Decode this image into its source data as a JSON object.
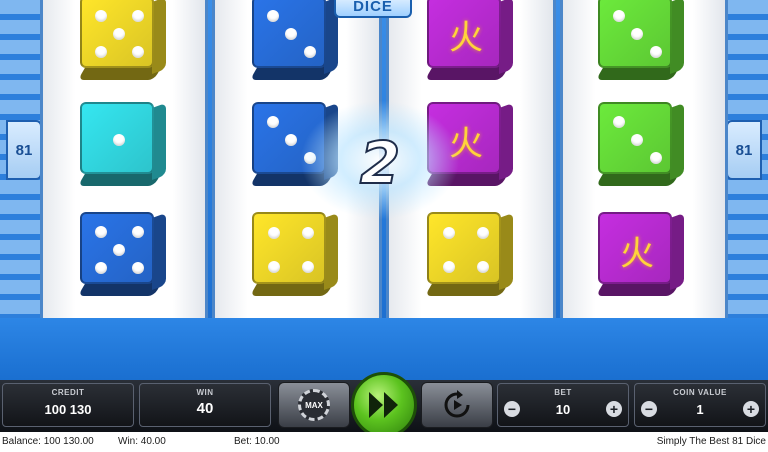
{
  "header": {
    "title_tag": "DICE"
  },
  "side_badges": {
    "left": "81",
    "right": "81"
  },
  "win_indicator": "2",
  "colors": {
    "yellow": "#ffe62a",
    "cyan": "#35e6f0",
    "blue": "#2a74e8",
    "magenta": "#c52ee0",
    "green": "#6cea3c"
  },
  "reels": [
    {
      "name": "reel-1",
      "dice": [
        {
          "color": "yellow",
          "symbol": "five",
          "icon": "die-five-icon"
        },
        {
          "color": "cyan",
          "symbol": "one",
          "icon": "die-one-icon"
        },
        {
          "color": "blue",
          "symbol": "five",
          "icon": "die-five-icon"
        }
      ]
    },
    {
      "name": "reel-2",
      "dice": [
        {
          "color": "blue",
          "symbol": "three",
          "icon": "die-three-icon"
        },
        {
          "color": "blue",
          "symbol": "three",
          "icon": "die-three-icon"
        },
        {
          "color": "yellow",
          "symbol": "four",
          "icon": "die-four-icon"
        }
      ]
    },
    {
      "name": "reel-3",
      "dice": [
        {
          "color": "magenta",
          "symbol": "fire",
          "icon": "fire-glyph-icon",
          "glyph": "火"
        },
        {
          "color": "magenta",
          "symbol": "fire",
          "icon": "fire-glyph-icon",
          "glyph": "火"
        },
        {
          "color": "yellow",
          "symbol": "four",
          "icon": "die-four-icon"
        }
      ]
    },
    {
      "name": "reel-4",
      "dice": [
        {
          "color": "green",
          "symbol": "three",
          "icon": "die-three-icon"
        },
        {
          "color": "green",
          "symbol": "three",
          "icon": "die-three-icon"
        },
        {
          "color": "magenta",
          "symbol": "fire",
          "icon": "fire-glyph-icon",
          "glyph": "火"
        }
      ]
    }
  ],
  "controls": {
    "credit": {
      "label": "CREDIT",
      "value": "100 130"
    },
    "win": {
      "label": "WIN",
      "value": "40"
    },
    "max_button": {
      "label": "MAX",
      "icon": "max-bet-chip-icon"
    },
    "spin_button": {
      "icon": "fast-forward-icon"
    },
    "autoplay_button": {
      "icon": "autoplay-icon"
    },
    "bet": {
      "label": "BET",
      "value": "10",
      "minus": "−",
      "plus": "+"
    },
    "coin_value": {
      "label": "COIN VALUE",
      "value": "1",
      "minus": "−",
      "plus": "+"
    }
  },
  "status_bar": {
    "balance": "Balance: 100 130.00",
    "win": "Win: 40.00",
    "bet": "Bet: 10.00",
    "game_name": "Simply The Best 81 Dice"
  }
}
